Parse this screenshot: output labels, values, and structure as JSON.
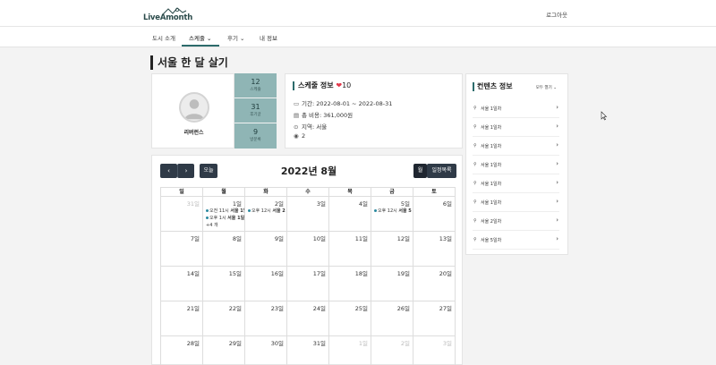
{
  "header": {
    "logo_text": "LiveAmonth",
    "logout": "로그아웃"
  },
  "nav": {
    "items": [
      {
        "label": "도시 소개",
        "active": false,
        "dropdown": false
      },
      {
        "label": "스케줄",
        "active": true,
        "dropdown": true
      },
      {
        "label": "후기",
        "active": false,
        "dropdown": true
      },
      {
        "label": "내 정보",
        "active": false,
        "dropdown": false
      }
    ]
  },
  "page_title": "서울 한 달 살기",
  "profile": {
    "name": "리버런스"
  },
  "stats": [
    {
      "value": "12",
      "label": "스케줄"
    },
    {
      "value": "31",
      "label": "후기글"
    },
    {
      "value": "9",
      "label": "방문록"
    }
  ],
  "schedule": {
    "title": "스케줄 정보",
    "likes": "10",
    "period": "기간: 2022-08-01 ~ 2022-08-31",
    "cost": "총 비용: 361,000원",
    "region": "지역: 서울",
    "views": "2"
  },
  "calendar": {
    "prev": "‹",
    "next": "›",
    "today": "오늘",
    "month": "2022년 8월",
    "view_month": "월",
    "view_list": "일정목록",
    "weekdays": [
      "일",
      "월",
      "화",
      "수",
      "목",
      "금",
      "토"
    ],
    "weeks": [
      [
        {
          "date": "31일",
          "muted": true,
          "events": []
        },
        {
          "date": "1일",
          "muted": false,
          "events": [
            {
              "time": "오전 11시",
              "title": "서울 1일"
            },
            {
              "time": "오후 1시",
              "title": "서울 1일"
            }
          ],
          "more": "+4 개"
        },
        {
          "date": "2일",
          "muted": false,
          "events": [
            {
              "time": "오후 12시",
              "title": "서울 2"
            }
          ]
        },
        {
          "date": "3일",
          "muted": false,
          "events": []
        },
        {
          "date": "4일",
          "muted": false,
          "events": []
        },
        {
          "date": "5일",
          "muted": false,
          "events": [
            {
              "time": "오후 12시",
              "title": "서울 5"
            }
          ]
        },
        {
          "date": "6일",
          "muted": false,
          "events": []
        }
      ],
      [
        {
          "date": "7일",
          "muted": false,
          "events": []
        },
        {
          "date": "8일",
          "muted": false,
          "events": []
        },
        {
          "date": "9일",
          "muted": false,
          "events": []
        },
        {
          "date": "10일",
          "muted": false,
          "events": []
        },
        {
          "date": "11일",
          "muted": false,
          "events": []
        },
        {
          "date": "12일",
          "muted": false,
          "events": []
        },
        {
          "date": "13일",
          "muted": false,
          "events": []
        }
      ],
      [
        {
          "date": "14일",
          "muted": false,
          "events": []
        },
        {
          "date": "15일",
          "muted": false,
          "events": []
        },
        {
          "date": "16일",
          "muted": false,
          "events": []
        },
        {
          "date": "17일",
          "muted": false,
          "events": []
        },
        {
          "date": "18일",
          "muted": false,
          "events": []
        },
        {
          "date": "19일",
          "muted": false,
          "events": []
        },
        {
          "date": "20일",
          "muted": false,
          "events": []
        }
      ],
      [
        {
          "date": "21일",
          "muted": false,
          "events": []
        },
        {
          "date": "22일",
          "muted": false,
          "events": []
        },
        {
          "date": "23일",
          "muted": false,
          "events": []
        },
        {
          "date": "24일",
          "muted": false,
          "events": []
        },
        {
          "date": "25일",
          "muted": false,
          "events": []
        },
        {
          "date": "26일",
          "muted": false,
          "events": []
        },
        {
          "date": "27일",
          "muted": false,
          "events": []
        }
      ],
      [
        {
          "date": "28일",
          "muted": false,
          "events": []
        },
        {
          "date": "29일",
          "muted": false,
          "events": []
        },
        {
          "date": "30일",
          "muted": false,
          "events": []
        },
        {
          "date": "31일",
          "muted": false,
          "events": []
        },
        {
          "date": "1일",
          "muted": true,
          "events": []
        },
        {
          "date": "2일",
          "muted": true,
          "events": []
        },
        {
          "date": "3일",
          "muted": true,
          "events": []
        }
      ]
    ]
  },
  "contents": {
    "title": "컨텐츠 정보",
    "view_all": "모두 열기",
    "items": [
      "서울 1일차",
      "서울 1일차",
      "서울 1일차",
      "서울 1일차",
      "서울 1일차",
      "서울 1일차",
      "서울 2일차",
      "서울 5일차"
    ]
  },
  "colors": {
    "accent": "#2c6b6b",
    "stat_bg": "#8fb5b5",
    "button_dark": "#2f3a47",
    "heart": "#e2374a",
    "event_dot": "#2c8aa0"
  }
}
